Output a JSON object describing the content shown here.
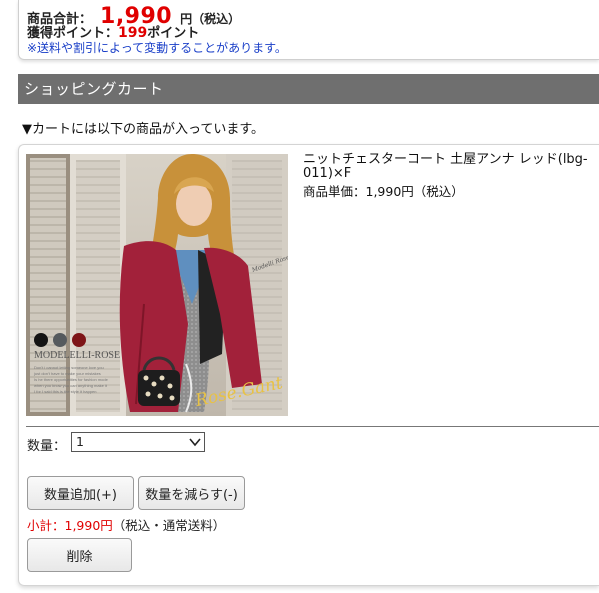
{
  "summary": {
    "total_label": "商品合計：",
    "total_value": "1,990",
    "total_unit": "円",
    "total_tax": "（税込）",
    "points_label": "獲得ポイント：",
    "points_value": "199",
    "points_unit": "ポイント",
    "note": "※送料や割引によって変動することがあります。"
  },
  "section": {
    "title": "ショッピングカート"
  },
  "cart": {
    "notice": "▼カートには以下の商品が入っています。",
    "item": {
      "name": "ニットチェスターコート 土屋アンナ レッド(lbg-011)×F",
      "unit_price": "商品単価：1,990円（税込）",
      "image_brand": "MODELELLI-ROSE",
      "image_script": "Rose.Gant",
      "image_sign": "Modelli Rose",
      "image_caption": [
        "Don't i cannot letting someone love you",
        "just don't have to make your mistakes",
        "Is he there opportunities for fashion mode",
        "when you know you can anything make it",
        "I for I said this is the style it happen"
      ],
      "swatch_colors": [
        "#141414",
        "#555a5e",
        "#7e1518"
      ],
      "coat_color": "#a2213a"
    },
    "quantity": {
      "label": "数量：",
      "value": "1"
    },
    "buttons": {
      "add": "数量追加(+)",
      "reduce": "数量を減らす(-)",
      "delete": "削除"
    },
    "subtotal": {
      "label": "小計：1,990円",
      "note": "（税込・通常送料）"
    }
  }
}
